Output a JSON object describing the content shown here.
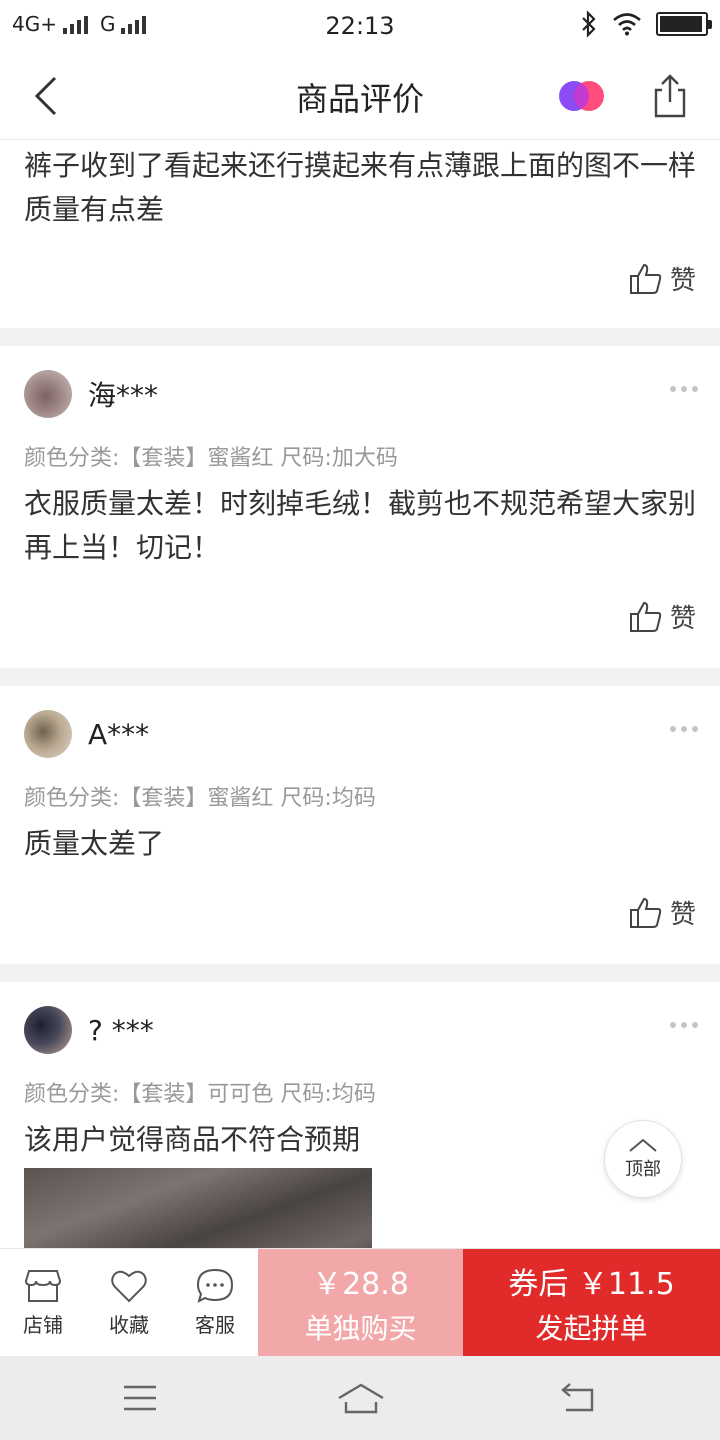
{
  "status_bar": {
    "network_left": "4G+",
    "network_right": "G",
    "time": "22:13",
    "icons": [
      "signal-icon",
      "bluetooth-icon",
      "wifi-icon",
      "battery-icon"
    ]
  },
  "nav": {
    "title": "商品评价",
    "back_icon": "back-arrow-icon",
    "logo_icon": "brand-logo-icon",
    "share_icon": "share-icon"
  },
  "reviews": [
    {
      "text": "裤子收到了看起来还行摸起来有点薄跟上面的图不一样质量有点差",
      "like_label": "赞"
    },
    {
      "username": "海***",
      "sku": "颜色分类:【套装】蜜酱红  尺码:加大码",
      "text": "衣服质量太差！时刻掉毛绒！截剪也不规范希望大家别再上当！切记！",
      "like_label": "赞"
    },
    {
      "username": "A***",
      "sku": "颜色分类:【套装】蜜酱红  尺码:均码",
      "text": "质量太差了",
      "like_label": "赞"
    },
    {
      "username": "? ***",
      "sku": "颜色分类:【套装】可可色  尺码:均码",
      "text": "该用户觉得商品不符合预期"
    }
  ],
  "back_to_top": {
    "label": "顶部"
  },
  "actions": {
    "store": "店铺",
    "favorite": "收藏",
    "service": "客服"
  },
  "buy_solo": {
    "price": "￥28.8",
    "label": "单独购买"
  },
  "buy_group": {
    "price": "券后 ￥11.5",
    "label": "发起拼单"
  },
  "colors": {
    "solo_bg": "#f2a8a8",
    "group_bg": "#e12a2a",
    "logo_purple": "#8a4df5",
    "logo_pink": "#ff3a6e"
  }
}
